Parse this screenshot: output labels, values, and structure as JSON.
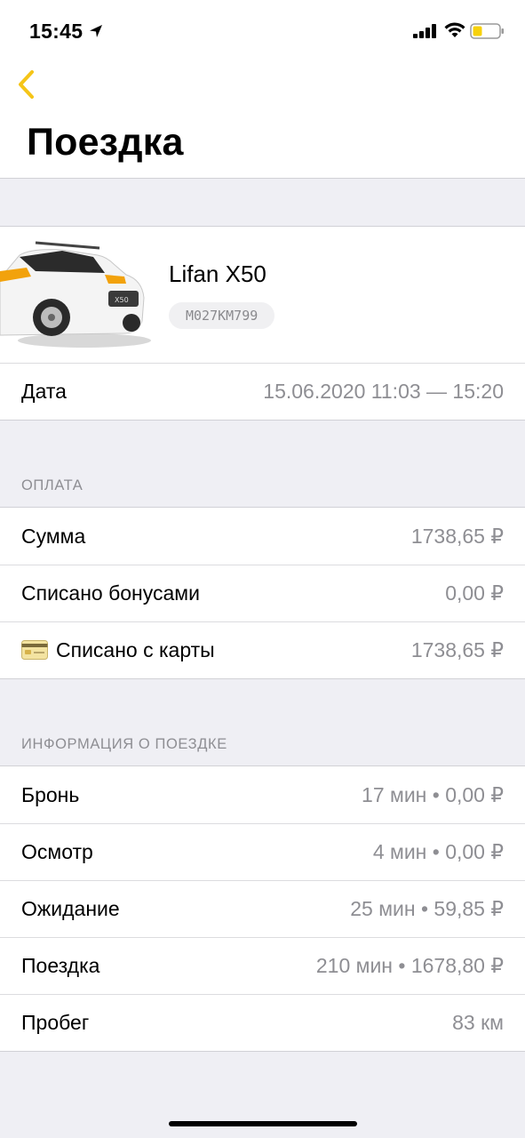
{
  "status_bar": {
    "time": "15:45"
  },
  "header": {
    "title": "Поездка"
  },
  "car": {
    "name": "Lifan X50",
    "plate": "M027KM799"
  },
  "date": {
    "label": "Дата",
    "value": "15.06.2020 11:03 — 15:20"
  },
  "payment": {
    "section_title": "ОПЛАТА",
    "rows": [
      {
        "label": "Сумма",
        "value": "1738,65 ₽"
      },
      {
        "label": "Списано бонусами",
        "value": "0,00 ₽"
      },
      {
        "label": "Списано с карты",
        "value": "1738,65 ₽",
        "icon": "credit-card-icon"
      }
    ]
  },
  "trip_info": {
    "section_title": "ИНФОРМАЦИЯ О ПОЕЗДКЕ",
    "rows": [
      {
        "label": "Бронь",
        "value": "17 мин • 0,00 ₽"
      },
      {
        "label": "Осмотр",
        "value": "4 мин • 0,00 ₽"
      },
      {
        "label": "Ожидание",
        "value": "25 мин • 59,85 ₽"
      },
      {
        "label": "Поездка",
        "value": "210 мин • 1678,80 ₽"
      },
      {
        "label": "Пробег",
        "value": "83 км"
      }
    ]
  },
  "colors": {
    "accent": "#f5c518",
    "background": "#efeff4",
    "secondary_text": "#8e8e93"
  }
}
